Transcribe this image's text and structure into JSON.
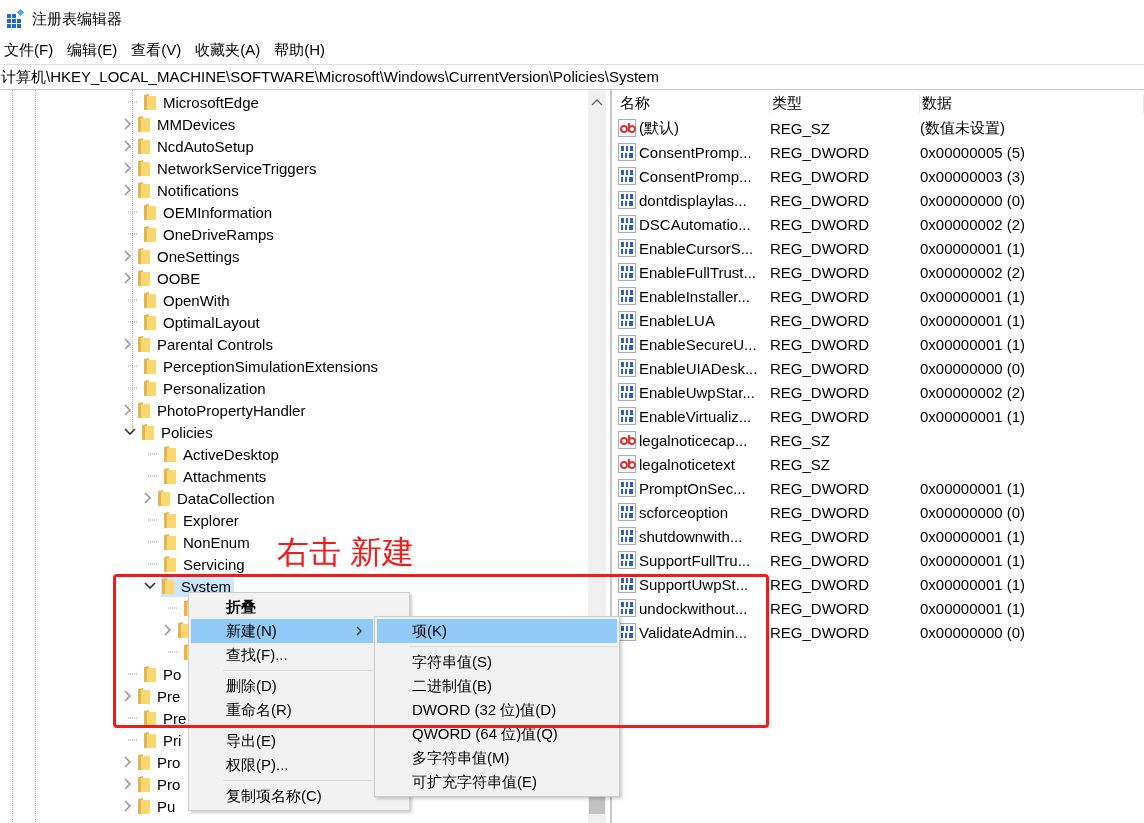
{
  "window": {
    "title": "注册表编辑器"
  },
  "menu_bar": [
    "文件(F)",
    "编辑(E)",
    "查看(V)",
    "收藏夹(A)",
    "帮助(H)"
  ],
  "address": "计算机\\HKEY_LOCAL_MACHINE\\SOFTWARE\\Microsoft\\Windows\\CurrentVersion\\Policies\\System",
  "tree": [
    {
      "label": "MicrosoftEdge",
      "expandable": false,
      "selected": false
    },
    {
      "label": "MMDevices",
      "expandable": true,
      "expanded": false,
      "selected": false
    },
    {
      "label": "NcdAutoSetup",
      "expandable": true,
      "expanded": false,
      "selected": false
    },
    {
      "label": "NetworkServiceTriggers",
      "expandable": true,
      "expanded": false,
      "selected": false
    },
    {
      "label": "Notifications",
      "expandable": true,
      "expanded": false,
      "selected": false
    },
    {
      "label": "OEMInformation",
      "expandable": false,
      "selected": false
    },
    {
      "label": "OneDriveRamps",
      "expandable": false,
      "selected": false
    },
    {
      "label": "OneSettings",
      "expandable": true,
      "expanded": false,
      "selected": false
    },
    {
      "label": "OOBE",
      "expandable": true,
      "expanded": false,
      "selected": false
    },
    {
      "label": "OpenWith",
      "expandable": false,
      "selected": false
    },
    {
      "label": "OptimalLayout",
      "expandable": false,
      "selected": false
    },
    {
      "label": "Parental Controls",
      "expandable": true,
      "expanded": false,
      "selected": false
    },
    {
      "label": "PerceptionSimulationExtensions",
      "expandable": false,
      "selected": false
    },
    {
      "label": "Personalization",
      "expandable": false,
      "selected": false
    },
    {
      "label": "PhotoPropertyHandler",
      "expandable": true,
      "expanded": false,
      "selected": false
    },
    {
      "label": "Policies",
      "expandable": true,
      "expanded": true,
      "selected": false,
      "children": [
        {
          "label": "ActiveDesktop",
          "expandable": false,
          "selected": false
        },
        {
          "label": "Attachments",
          "expandable": false,
          "selected": false
        },
        {
          "label": "DataCollection",
          "expandable": true,
          "expanded": false,
          "selected": false
        },
        {
          "label": "Explorer",
          "expandable": false,
          "selected": false
        },
        {
          "label": "NonEnum",
          "expandable": false,
          "selected": false
        },
        {
          "label": "Servicing",
          "expandable": false,
          "selected": false
        },
        {
          "label": "System",
          "expandable": true,
          "expanded": true,
          "selected": true,
          "children": [
            {
              "expandable": false
            },
            {
              "expandable": true
            },
            {
              "expandable": false
            }
          ]
        }
      ]
    },
    {
      "label": "Po",
      "expandable": false,
      "selected": false
    },
    {
      "label": "Pre",
      "expandable": true,
      "expanded": false,
      "selected": false
    },
    {
      "label": "Pre",
      "expandable": false,
      "selected": false
    },
    {
      "label": "Pri",
      "expandable": false,
      "selected": false
    },
    {
      "label": "Pro",
      "expandable": true,
      "expanded": false,
      "selected": false
    },
    {
      "label": "Pro",
      "expandable": true,
      "expanded": false,
      "selected": false
    },
    {
      "label": "Pu",
      "expandable": true,
      "expanded": false,
      "selected": false
    }
  ],
  "values_table": {
    "columns": [
      "名称",
      "类型",
      "数据"
    ],
    "rows": [
      {
        "kind": "sz",
        "name": "(默认)",
        "type": "REG_SZ",
        "data": "(数值未设置)"
      },
      {
        "kind": "dword",
        "name": "ConsentPromp...",
        "type": "REG_DWORD",
        "data": "0x00000005 (5)"
      },
      {
        "kind": "dword",
        "name": "ConsentPromp...",
        "type": "REG_DWORD",
        "data": "0x00000003 (3)"
      },
      {
        "kind": "dword",
        "name": "dontdisplaylas...",
        "type": "REG_DWORD",
        "data": "0x00000000 (0)"
      },
      {
        "kind": "dword",
        "name": "DSCAutomatio...",
        "type": "REG_DWORD",
        "data": "0x00000002 (2)"
      },
      {
        "kind": "dword",
        "name": "EnableCursorS...",
        "type": "REG_DWORD",
        "data": "0x00000001 (1)"
      },
      {
        "kind": "dword",
        "name": "EnableFullTrust...",
        "type": "REG_DWORD",
        "data": "0x00000002 (2)"
      },
      {
        "kind": "dword",
        "name": "EnableInstaller...",
        "type": "REG_DWORD",
        "data": "0x00000001 (1)"
      },
      {
        "kind": "dword",
        "name": "EnableLUA",
        "type": "REG_DWORD",
        "data": "0x00000001 (1)"
      },
      {
        "kind": "dword",
        "name": "EnableSecureU...",
        "type": "REG_DWORD",
        "data": "0x00000001 (1)"
      },
      {
        "kind": "dword",
        "name": "EnableUIADesk...",
        "type": "REG_DWORD",
        "data": "0x00000000 (0)"
      },
      {
        "kind": "dword",
        "name": "EnableUwpStar...",
        "type": "REG_DWORD",
        "data": "0x00000002 (2)"
      },
      {
        "kind": "dword",
        "name": "EnableVirtualiz...",
        "type": "REG_DWORD",
        "data": "0x00000001 (1)"
      },
      {
        "kind": "sz",
        "name": "legalnoticecap...",
        "type": "REG_SZ"
      },
      {
        "kind": "sz",
        "name": "legalnoticetext",
        "type": "REG_SZ"
      },
      {
        "kind": "dword",
        "name": "PromptOnSec...",
        "type": "REG_DWORD",
        "data": "0x00000001 (1)"
      },
      {
        "kind": "dword",
        "name": "scforceoption",
        "type": "REG_DWORD",
        "data": "0x00000000 (0)"
      },
      {
        "kind": "dword",
        "name": "shutdownwith...",
        "type": "REG_DWORD",
        "data": "0x00000001 (1)"
      },
      {
        "kind": "dword",
        "name": "SupportFullTru...",
        "type": "REG_DWORD",
        "data": "0x00000001 (1)"
      },
      {
        "kind": "dword",
        "name": "SupportUwpSt...",
        "type": "REG_DWORD",
        "data": "0x00000001 (1)"
      },
      {
        "kind": "dword",
        "name": "undockwithout...",
        "type": "REG_DWORD",
        "data": "0x00000001 (1)"
      },
      {
        "kind": "dword",
        "name": "ValidateAdmin...",
        "type": "REG_DWORD",
        "data": "0x00000000 (0)"
      }
    ]
  },
  "context_menu": {
    "items": [
      {
        "kind": "item",
        "label": "折叠",
        "bold": true,
        "selected": false,
        "submenu": false
      },
      {
        "kind": "item",
        "label": "新建(N)",
        "bold": false,
        "selected": true,
        "submenu": true
      },
      {
        "kind": "item",
        "label": "查找(F)...",
        "bold": false,
        "selected": false,
        "submenu": false
      },
      {
        "kind": "separator"
      },
      {
        "kind": "item",
        "label": "删除(D)",
        "bold": false,
        "selected": false,
        "submenu": false
      },
      {
        "kind": "item",
        "label": "重命名(R)",
        "bold": false,
        "selected": false,
        "submenu": false
      },
      {
        "kind": "separator"
      },
      {
        "kind": "item",
        "label": "导出(E)",
        "bold": false,
        "selected": false,
        "submenu": false
      },
      {
        "kind": "item",
        "label": "权限(P)...",
        "bold": false,
        "selected": false,
        "submenu": false
      },
      {
        "kind": "separator"
      },
      {
        "kind": "item",
        "label": "复制项名称(C)",
        "bold": false,
        "selected": false,
        "submenu": false
      }
    ]
  },
  "submenu": {
    "items": [
      {
        "kind": "item",
        "label": "项(K)",
        "selected": true
      },
      {
        "kind": "separator"
      },
      {
        "kind": "item",
        "label": "字符串值(S)",
        "selected": false
      },
      {
        "kind": "item",
        "label": "二进制值(B)",
        "selected": false
      },
      {
        "kind": "item",
        "label": "DWORD (32 位)值(D)",
        "selected": false
      },
      {
        "kind": "item",
        "label": "QWORD (64 位)值(Q)",
        "selected": false
      },
      {
        "kind": "item",
        "label": "多字符串值(M)",
        "selected": false
      },
      {
        "kind": "item",
        "label": "可扩充字符串值(E)",
        "selected": false
      }
    ]
  },
  "annotation": {
    "text": "右击 新建"
  }
}
